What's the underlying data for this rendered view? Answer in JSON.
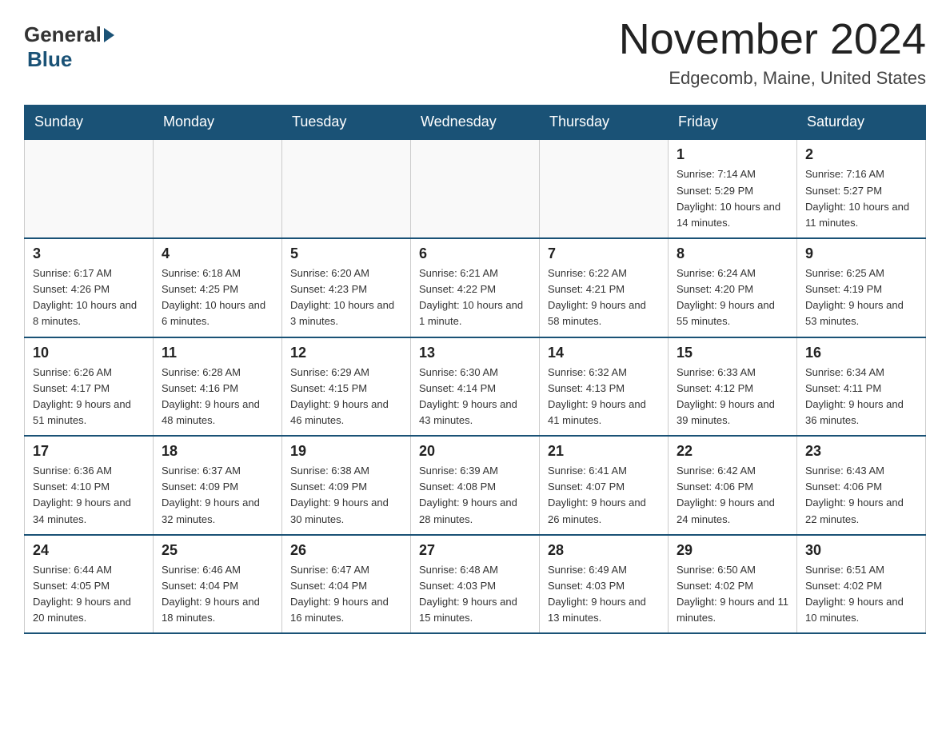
{
  "header": {
    "logo_general": "General",
    "logo_blue": "Blue",
    "month_title": "November 2024",
    "location": "Edgecomb, Maine, United States"
  },
  "weekdays": [
    "Sunday",
    "Monday",
    "Tuesday",
    "Wednesday",
    "Thursday",
    "Friday",
    "Saturday"
  ],
  "weeks": [
    [
      {
        "day": "",
        "info": ""
      },
      {
        "day": "",
        "info": ""
      },
      {
        "day": "",
        "info": ""
      },
      {
        "day": "",
        "info": ""
      },
      {
        "day": "",
        "info": ""
      },
      {
        "day": "1",
        "info": "Sunrise: 7:14 AM\nSunset: 5:29 PM\nDaylight: 10 hours and 14 minutes."
      },
      {
        "day": "2",
        "info": "Sunrise: 7:16 AM\nSunset: 5:27 PM\nDaylight: 10 hours and 11 minutes."
      }
    ],
    [
      {
        "day": "3",
        "info": "Sunrise: 6:17 AM\nSunset: 4:26 PM\nDaylight: 10 hours and 8 minutes."
      },
      {
        "day": "4",
        "info": "Sunrise: 6:18 AM\nSunset: 4:25 PM\nDaylight: 10 hours and 6 minutes."
      },
      {
        "day": "5",
        "info": "Sunrise: 6:20 AM\nSunset: 4:23 PM\nDaylight: 10 hours and 3 minutes."
      },
      {
        "day": "6",
        "info": "Sunrise: 6:21 AM\nSunset: 4:22 PM\nDaylight: 10 hours and 1 minute."
      },
      {
        "day": "7",
        "info": "Sunrise: 6:22 AM\nSunset: 4:21 PM\nDaylight: 9 hours and 58 minutes."
      },
      {
        "day": "8",
        "info": "Sunrise: 6:24 AM\nSunset: 4:20 PM\nDaylight: 9 hours and 55 minutes."
      },
      {
        "day": "9",
        "info": "Sunrise: 6:25 AM\nSunset: 4:19 PM\nDaylight: 9 hours and 53 minutes."
      }
    ],
    [
      {
        "day": "10",
        "info": "Sunrise: 6:26 AM\nSunset: 4:17 PM\nDaylight: 9 hours and 51 minutes."
      },
      {
        "day": "11",
        "info": "Sunrise: 6:28 AM\nSunset: 4:16 PM\nDaylight: 9 hours and 48 minutes."
      },
      {
        "day": "12",
        "info": "Sunrise: 6:29 AM\nSunset: 4:15 PM\nDaylight: 9 hours and 46 minutes."
      },
      {
        "day": "13",
        "info": "Sunrise: 6:30 AM\nSunset: 4:14 PM\nDaylight: 9 hours and 43 minutes."
      },
      {
        "day": "14",
        "info": "Sunrise: 6:32 AM\nSunset: 4:13 PM\nDaylight: 9 hours and 41 minutes."
      },
      {
        "day": "15",
        "info": "Sunrise: 6:33 AM\nSunset: 4:12 PM\nDaylight: 9 hours and 39 minutes."
      },
      {
        "day": "16",
        "info": "Sunrise: 6:34 AM\nSunset: 4:11 PM\nDaylight: 9 hours and 36 minutes."
      }
    ],
    [
      {
        "day": "17",
        "info": "Sunrise: 6:36 AM\nSunset: 4:10 PM\nDaylight: 9 hours and 34 minutes."
      },
      {
        "day": "18",
        "info": "Sunrise: 6:37 AM\nSunset: 4:09 PM\nDaylight: 9 hours and 32 minutes."
      },
      {
        "day": "19",
        "info": "Sunrise: 6:38 AM\nSunset: 4:09 PM\nDaylight: 9 hours and 30 minutes."
      },
      {
        "day": "20",
        "info": "Sunrise: 6:39 AM\nSunset: 4:08 PM\nDaylight: 9 hours and 28 minutes."
      },
      {
        "day": "21",
        "info": "Sunrise: 6:41 AM\nSunset: 4:07 PM\nDaylight: 9 hours and 26 minutes."
      },
      {
        "day": "22",
        "info": "Sunrise: 6:42 AM\nSunset: 4:06 PM\nDaylight: 9 hours and 24 minutes."
      },
      {
        "day": "23",
        "info": "Sunrise: 6:43 AM\nSunset: 4:06 PM\nDaylight: 9 hours and 22 minutes."
      }
    ],
    [
      {
        "day": "24",
        "info": "Sunrise: 6:44 AM\nSunset: 4:05 PM\nDaylight: 9 hours and 20 minutes."
      },
      {
        "day": "25",
        "info": "Sunrise: 6:46 AM\nSunset: 4:04 PM\nDaylight: 9 hours and 18 minutes."
      },
      {
        "day": "26",
        "info": "Sunrise: 6:47 AM\nSunset: 4:04 PM\nDaylight: 9 hours and 16 minutes."
      },
      {
        "day": "27",
        "info": "Sunrise: 6:48 AM\nSunset: 4:03 PM\nDaylight: 9 hours and 15 minutes."
      },
      {
        "day": "28",
        "info": "Sunrise: 6:49 AM\nSunset: 4:03 PM\nDaylight: 9 hours and 13 minutes."
      },
      {
        "day": "29",
        "info": "Sunrise: 6:50 AM\nSunset: 4:02 PM\nDaylight: 9 hours and 11 minutes."
      },
      {
        "day": "30",
        "info": "Sunrise: 6:51 AM\nSunset: 4:02 PM\nDaylight: 9 hours and 10 minutes."
      }
    ]
  ]
}
